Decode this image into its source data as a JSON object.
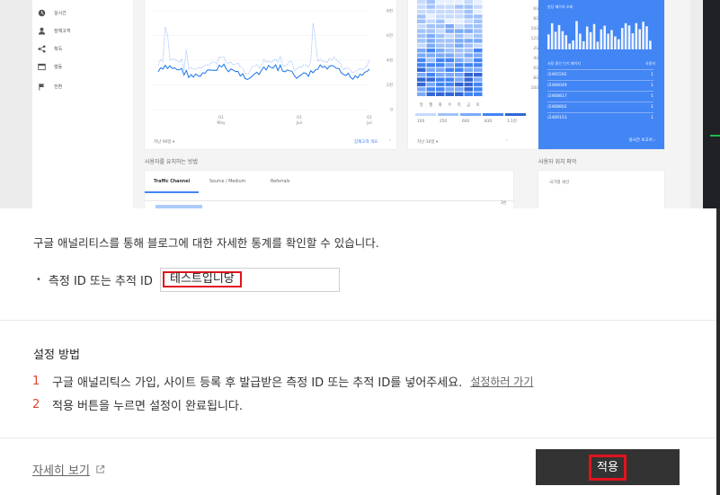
{
  "preview": {
    "sidebar": {
      "items": [
        {
          "label": "실시간",
          "icon": "clock-icon"
        },
        {
          "label": "잠재고객",
          "icon": "person-icon"
        },
        {
          "label": "획득",
          "icon": "share-icon"
        },
        {
          "label": "행동",
          "icon": "window-icon"
        },
        {
          "label": "전환",
          "icon": "flag-icon"
        }
      ]
    },
    "line_chart": {
      "y_ticks": [
        "8천",
        "6천",
        "4천",
        "2천",
        "0"
      ],
      "x_ticks": [
        "01\nMay",
        "01\nJun",
        "01\nJul"
      ],
      "x_ticks_split": [
        [
          "01",
          "May"
        ],
        [
          "01",
          "Jun"
        ],
        [
          "01",
          "Jul"
        ]
      ],
      "period": "지난 90일 ▾",
      "report_link": "잠재고객 개요"
    },
    "heatmap": {
      "hours": [
        "6오전",
        "8오전",
        "10오전",
        "12오후",
        "2오후",
        "4오후",
        "6오후",
        "8오후",
        "10오후"
      ],
      "days": [
        "일",
        "월",
        "화",
        "수",
        "목",
        "금",
        "토"
      ],
      "legend": [
        "100",
        "250",
        "600",
        "830",
        "1.1천"
      ],
      "period": "지난 30일 ▾"
    },
    "realtime": {
      "title": "분당 페이지 조회",
      "col_left": "사용 중인 인기 페이지",
      "col_right": "사용자",
      "rows": [
        {
          "path": "/2465592",
          "users": "1"
        },
        {
          "path": "/2466049",
          "users": "1"
        },
        {
          "path": "/2468817",
          "users": "1"
        },
        {
          "path": "/2468802",
          "users": "1"
        },
        {
          "path": "/2469153",
          "users": "1"
        }
      ],
      "footer": "실시간 보고서"
    },
    "section_left": "사용자를 유치하는 방법",
    "section_right": "사용자 위치 파악",
    "traffic_tabs": [
      "Traffic Channel",
      "Source / Medium",
      "Referrals"
    ],
    "traffic_value": "3천",
    "country_label": "국가별 세션"
  },
  "dialog": {
    "intro": "구글 애널리티스를 통해 블로그에 대한 자세한 통계를 확인할 수 있습니다.",
    "field_label": "측정 ID 또는 추적 ID",
    "field_value": "테스트입니당",
    "how_title": "설정 방법",
    "steps": [
      {
        "num": "1",
        "text": "구글 애널리틱스 가입, 사이트 등록 후 발급받은 측정 ID 또는 추적 ID를 넣어주세요.",
        "link": "설정하러 가기"
      },
      {
        "num": "2",
        "text": "적용 버튼을 누르면 설정이 완료됩니다."
      }
    ],
    "more_link": "자세히 보기",
    "more_icon": "external-link-icon",
    "apply_label": "적용"
  },
  "colors": {
    "accent_blue": "#4285f4",
    "highlight_red": "#e0141e",
    "step_number": "#e4432d",
    "button_bg": "#333333"
  }
}
